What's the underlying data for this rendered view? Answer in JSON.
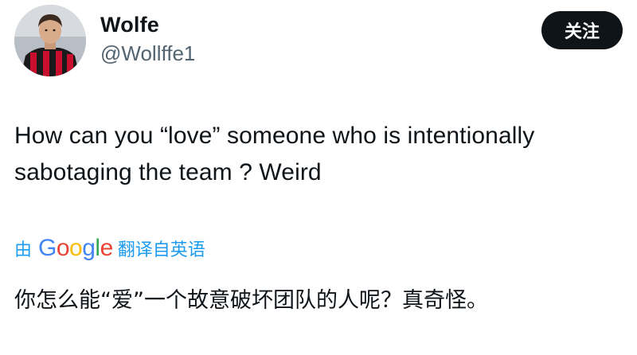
{
  "author": {
    "display_name": "Wolfe",
    "handle": "@Wollffe1",
    "avatar_icon": "profile-photo"
  },
  "follow_button": {
    "label": "关注"
  },
  "tweet": {
    "text": "How can you “love” someone who is intentionally sabotaging the team ? Weird"
  },
  "translation": {
    "prefix": "由",
    "provider": "Google",
    "suffix": "翻译自英语",
    "text": "你怎么能“爱”一个故意破坏团队的人呢？真奇怪。"
  },
  "colors": {
    "link_blue": "#1d9bf0",
    "text_primary": "#0f1419",
    "text_secondary": "#536471",
    "button_bg": "#0f1419",
    "google_blue": "#4285f4",
    "google_red": "#ea4335",
    "google_yellow": "#fbbc05",
    "google_green": "#34a853"
  }
}
